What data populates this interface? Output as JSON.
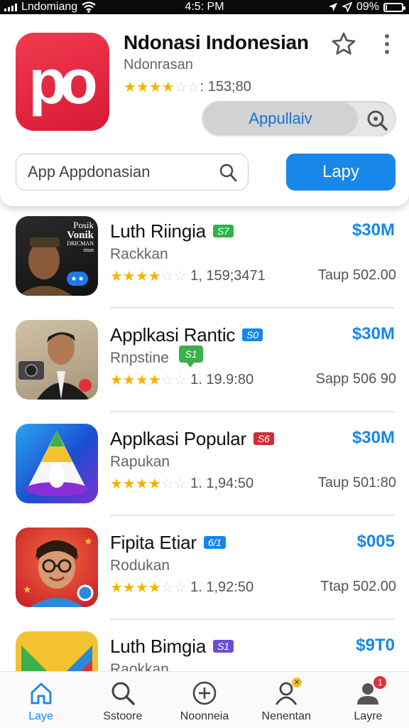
{
  "status_bar": {
    "carrier": "Lndomiang",
    "time": "4:5: PM",
    "battery": "09%",
    "battery_level": 0.09
  },
  "header": {
    "app_icon_text": "po",
    "title": "Ndonasi Indonesian",
    "subtitle": "Ndonrasan",
    "rating_text": ": 153;80",
    "rating_stars": 3.5,
    "toggle_label": "Appullaiv",
    "search_placeholder": "App Appdonasian",
    "primary_button": "Lapy"
  },
  "apps": [
    {
      "name": "Luth Riingia",
      "badge": "S7",
      "badge_color": "#2fb24a",
      "price": "$30M",
      "developer": "Rackkan",
      "rating_text": "1, 159;3471",
      "meta": "Taup 502.00",
      "thumb_text": [
        "Posik",
        "Vonik",
        "DRICMAN",
        "mun"
      ]
    },
    {
      "name": "Applkasi Rantic",
      "badge": "S0",
      "badge_color": "#1787ea",
      "price": "$30M",
      "developer": "Rnpstine",
      "chat_badge": "S1",
      "rating_text": "1. 19.9:80",
      "meta": "Sapp 506 90"
    },
    {
      "name": "Applkasi Popular",
      "badge": "S6",
      "badge_color": "#d22b3c",
      "price": "$30M",
      "developer": "Rapukan",
      "rating_text": "1. 1,94:50",
      "meta": "Taup 501:80"
    },
    {
      "name": "Fipita Etiar",
      "badge": "6/1",
      "badge_color": "#1787ea",
      "price": "$005",
      "developer": "Rodukan",
      "rating_text": "1. 1,92:50",
      "meta": "Ttap 502.00"
    },
    {
      "name": "Luth Bimgia",
      "badge": "S1",
      "badge_color": "#6a4fd6",
      "price": "$9T0",
      "developer": "Raokkan",
      "rating_text": "",
      "meta": ""
    }
  ],
  "tabs": [
    {
      "label": "Laye",
      "icon": "home-icon",
      "active": true
    },
    {
      "label": "Sstoore",
      "icon": "search-icon",
      "active": false
    },
    {
      "label": "Noonneia",
      "icon": "add-circle-icon",
      "active": false
    },
    {
      "label": "Nenentan",
      "icon": "person-icon",
      "active": false,
      "badge": "✕"
    },
    {
      "label": "Layre",
      "icon": "profile-icon",
      "active": false,
      "badge": "1"
    }
  ],
  "colors": {
    "accent": "#1787ea",
    "brand_red": "#e42840",
    "star": "#f0b400"
  }
}
